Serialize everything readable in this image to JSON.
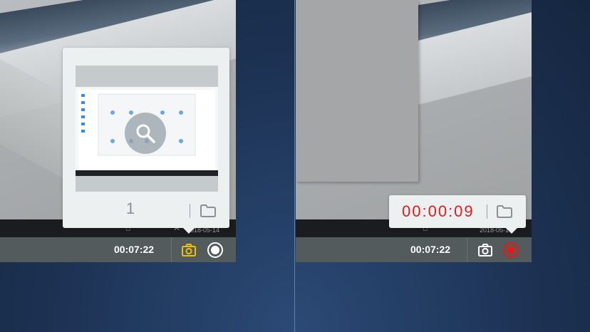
{
  "left_panel": {
    "tray_date": "2018-05-14",
    "timer": "00:07:22",
    "camera_icon_color": "#f0c000",
    "popup": {
      "screenshot_count": "1"
    }
  },
  "right_panel": {
    "tray_date": "2018-05-14",
    "timer": "00:07:22",
    "record_icon_color": "#e21a1a",
    "popup": {
      "recording_time": "00:00:09"
    }
  },
  "icons": [
    "camera-icon",
    "record-icon",
    "folder-icon",
    "search-icon"
  ]
}
